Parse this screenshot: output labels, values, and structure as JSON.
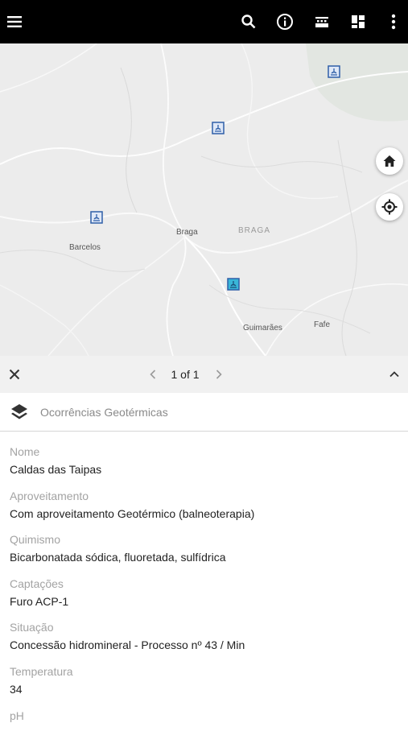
{
  "toolbar": {
    "menu_icon": "menu-icon",
    "actions": [
      "search-icon",
      "info-icon",
      "legend-icon",
      "dashboard-icon",
      "more-vert-icon"
    ]
  },
  "map": {
    "labels": {
      "barcelos": "Barcelos",
      "braga": "Braga",
      "braga_region": "BRAGA",
      "guimaraes": "Guimarães",
      "fafe": "Fafe"
    }
  },
  "popup": {
    "pager_text": "1 of 1",
    "layer_title": "Ocorrências Geotérmicas",
    "attributes": [
      {
        "key": "Nome",
        "value": "Caldas das Taipas"
      },
      {
        "key": "Aproveitamento",
        "value": "Com aproveitamento Geotérmico (balneoterapia)"
      },
      {
        "key": "Quimismo",
        "value": "Bicarbonatada sódica, fluoretada, sulfídrica"
      },
      {
        "key": "Captações",
        "value": "Furo ACP-1"
      },
      {
        "key": "Situação",
        "value": "Concessão hidromineral - Processo nº 43 / Min"
      },
      {
        "key": "Temperatura",
        "value": "34"
      },
      {
        "key": "pH",
        "value": ""
      }
    ]
  },
  "colors": {
    "toolbar_bg": "#000000",
    "map_bg": "#ececec",
    "marker_blue": "#2f5fa8",
    "selected_marker": "#39b6d8"
  }
}
